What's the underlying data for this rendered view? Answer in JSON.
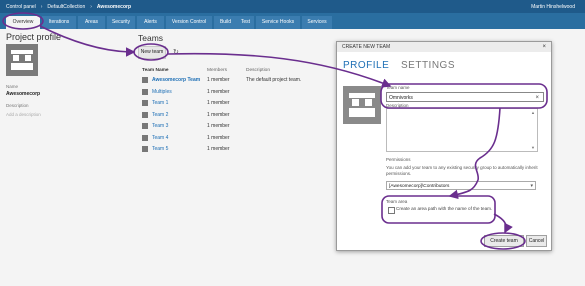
{
  "topbar": {
    "crumbs": [
      "Control panel",
      "DefaultCollection",
      "Awesomecorp"
    ],
    "user": "Martin Hinshelwood"
  },
  "tabs": [
    "Overview",
    "Iterations",
    "Areas",
    "Security",
    "Alerts",
    "Version Control",
    "Build",
    "Test",
    "Service Hooks",
    "Services"
  ],
  "profile": {
    "title": "Project profile",
    "name_label": "Name",
    "name_value": "Awesomecorp",
    "description_label": "Description",
    "description_placeholder": "Add a description"
  },
  "teams": {
    "title": "Teams",
    "new_team_label": "New team",
    "columns": [
      "Team Name",
      "Members",
      "Description"
    ],
    "rows": [
      {
        "name": "Awesomecorp Team",
        "members": "1 member",
        "description": "The default project team.",
        "bold": true
      },
      {
        "name": "Multiples",
        "members": "1 member",
        "description": ""
      },
      {
        "name": "Team 1",
        "members": "1 member",
        "description": ""
      },
      {
        "name": "Team 2",
        "members": "1 member",
        "description": ""
      },
      {
        "name": "Team 3",
        "members": "1 member",
        "description": ""
      },
      {
        "name": "Team 4",
        "members": "1 member",
        "description": ""
      },
      {
        "name": "Team 5",
        "members": "1 member",
        "description": ""
      }
    ]
  },
  "dialog": {
    "title": "CREATE NEW TEAM",
    "tab_profile": "PROFILE",
    "tab_settings": "SETTINGS",
    "team_name_label": "Team name",
    "team_name_value": "Omnivorks",
    "description_label": "Description",
    "permissions_label": "Permissions",
    "permissions_help": "You can add your team to any existing security group to automatically inherit permissions.",
    "permissions_value": "[Awesomecorp]\\Contributors",
    "team_area_label": "Team area",
    "team_area_checkbox_label": "Create an area path with the name of the team.",
    "create_label": "Create team",
    "cancel_label": "Cancel"
  },
  "colors": {
    "topbar": "#1f5a8a",
    "tabstrip": "#2a6ea0",
    "accent": "#1e6fb5",
    "annotation": "#6a2e8e"
  }
}
